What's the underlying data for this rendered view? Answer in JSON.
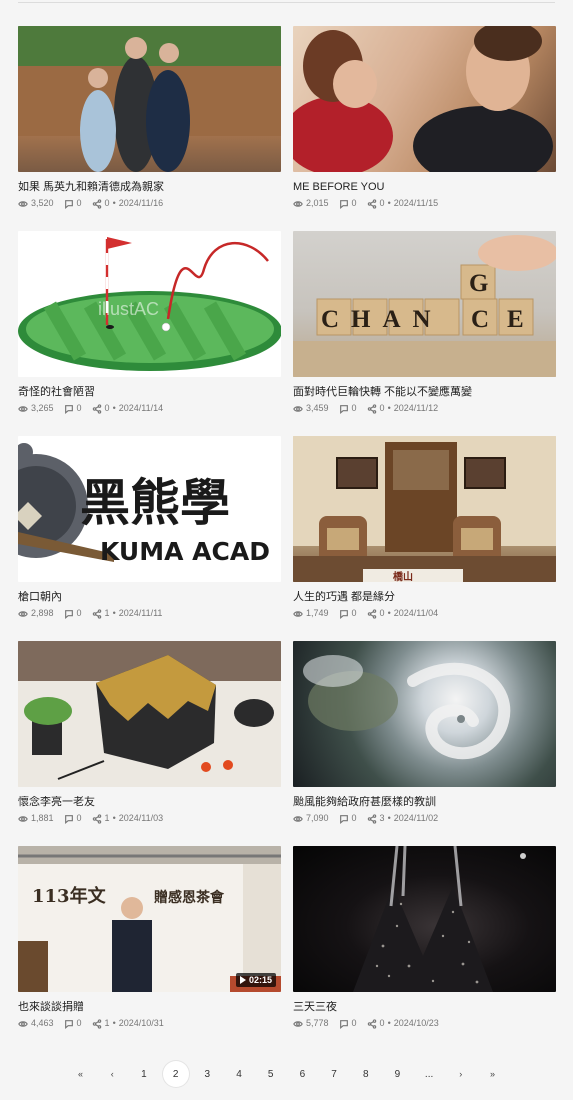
{
  "posts": [
    {
      "title": "如果 馬英九和賴清德成為親家",
      "views": "3,520",
      "comments": "0",
      "shares": "0",
      "date": "2024/11/16"
    },
    {
      "title": "ME BEFORE YOU",
      "views": "2,015",
      "comments": "0",
      "shares": "0",
      "date": "2024/11/15"
    },
    {
      "title": "奇怪的社會陋習",
      "views": "3,265",
      "comments": "0",
      "shares": "0",
      "date": "2024/11/14"
    },
    {
      "title": "面對時代巨輪快轉 不能以不變應萬變",
      "views": "3,459",
      "comments": "0",
      "shares": "0",
      "date": "2024/11/12"
    },
    {
      "title": "槍口朝內",
      "views": "2,898",
      "comments": "0",
      "shares": "1",
      "date": "2024/11/11"
    },
    {
      "title": "人生的巧遇 都是緣分",
      "views": "1,749",
      "comments": "0",
      "shares": "0",
      "date": "2024/11/04"
    },
    {
      "title": "懷念李亮一老友",
      "views": "1,881",
      "comments": "0",
      "shares": "1",
      "date": "2024/11/03"
    },
    {
      "title": "颱風能夠給政府甚麼樣的教訓",
      "views": "7,090",
      "comments": "0",
      "shares": "3",
      "date": "2024/11/02"
    },
    {
      "title": "也來談談捐贈",
      "views": "4,463",
      "comments": "0",
      "shares": "1",
      "date": "2024/10/31"
    },
    {
      "title": "三天三夜",
      "views": "5,778",
      "comments": "0",
      "shares": "0",
      "date": "2024/10/23"
    }
  ],
  "thumb_text": {
    "change_main": "CHAN",
    "change_g": "G",
    "change_c": "C",
    "change_e": "E",
    "kuma_big": "黑熊學",
    "kuma_small": "KUMA ACAD",
    "watermark": "illustAC",
    "banner": "113年文",
    "banner2": "贈感恩茶會",
    "sign": "橋山"
  },
  "video_duration": "02:15",
  "pagination": {
    "first": "«",
    "prev": "‹",
    "pages": [
      "1",
      "2",
      "3",
      "4",
      "5",
      "6",
      "7",
      "8",
      "9"
    ],
    "ellipsis": "...",
    "next": "›",
    "last": "»",
    "current": "2"
  },
  "colors": {
    "background": "#f5f5f5",
    "title": "#1f1f1f",
    "meta": "#777777",
    "golf_green": "#4caf50",
    "flag_red": "#d32f2f"
  }
}
